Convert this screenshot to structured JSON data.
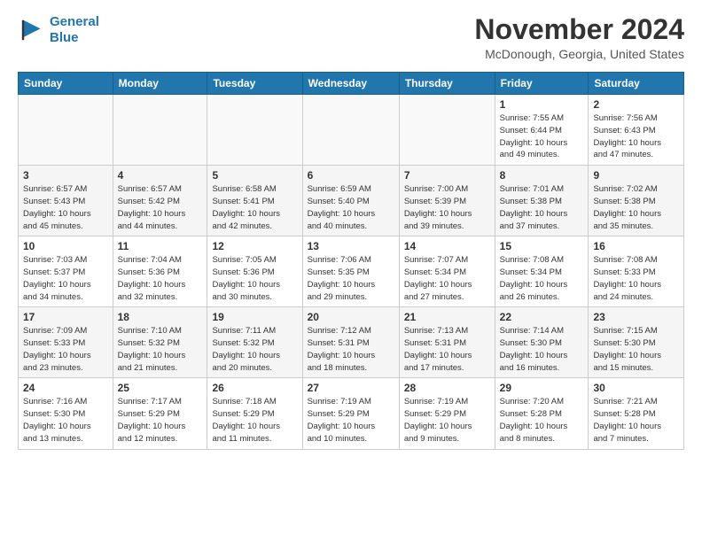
{
  "header": {
    "logo_line1": "General",
    "logo_line2": "Blue",
    "month": "November 2024",
    "location": "McDonough, Georgia, United States"
  },
  "days_of_week": [
    "Sunday",
    "Monday",
    "Tuesday",
    "Wednesday",
    "Thursday",
    "Friday",
    "Saturday"
  ],
  "weeks": [
    [
      {
        "day": "",
        "info": ""
      },
      {
        "day": "",
        "info": ""
      },
      {
        "day": "",
        "info": ""
      },
      {
        "day": "",
        "info": ""
      },
      {
        "day": "",
        "info": ""
      },
      {
        "day": "1",
        "info": "Sunrise: 7:55 AM\nSunset: 6:44 PM\nDaylight: 10 hours\nand 49 minutes."
      },
      {
        "day": "2",
        "info": "Sunrise: 7:56 AM\nSunset: 6:43 PM\nDaylight: 10 hours\nand 47 minutes."
      }
    ],
    [
      {
        "day": "3",
        "info": "Sunrise: 6:57 AM\nSunset: 5:43 PM\nDaylight: 10 hours\nand 45 minutes."
      },
      {
        "day": "4",
        "info": "Sunrise: 6:57 AM\nSunset: 5:42 PM\nDaylight: 10 hours\nand 44 minutes."
      },
      {
        "day": "5",
        "info": "Sunrise: 6:58 AM\nSunset: 5:41 PM\nDaylight: 10 hours\nand 42 minutes."
      },
      {
        "day": "6",
        "info": "Sunrise: 6:59 AM\nSunset: 5:40 PM\nDaylight: 10 hours\nand 40 minutes."
      },
      {
        "day": "7",
        "info": "Sunrise: 7:00 AM\nSunset: 5:39 PM\nDaylight: 10 hours\nand 39 minutes."
      },
      {
        "day": "8",
        "info": "Sunrise: 7:01 AM\nSunset: 5:38 PM\nDaylight: 10 hours\nand 37 minutes."
      },
      {
        "day": "9",
        "info": "Sunrise: 7:02 AM\nSunset: 5:38 PM\nDaylight: 10 hours\nand 35 minutes."
      }
    ],
    [
      {
        "day": "10",
        "info": "Sunrise: 7:03 AM\nSunset: 5:37 PM\nDaylight: 10 hours\nand 34 minutes."
      },
      {
        "day": "11",
        "info": "Sunrise: 7:04 AM\nSunset: 5:36 PM\nDaylight: 10 hours\nand 32 minutes."
      },
      {
        "day": "12",
        "info": "Sunrise: 7:05 AM\nSunset: 5:36 PM\nDaylight: 10 hours\nand 30 minutes."
      },
      {
        "day": "13",
        "info": "Sunrise: 7:06 AM\nSunset: 5:35 PM\nDaylight: 10 hours\nand 29 minutes."
      },
      {
        "day": "14",
        "info": "Sunrise: 7:07 AM\nSunset: 5:34 PM\nDaylight: 10 hours\nand 27 minutes."
      },
      {
        "day": "15",
        "info": "Sunrise: 7:08 AM\nSunset: 5:34 PM\nDaylight: 10 hours\nand 26 minutes."
      },
      {
        "day": "16",
        "info": "Sunrise: 7:08 AM\nSunset: 5:33 PM\nDaylight: 10 hours\nand 24 minutes."
      }
    ],
    [
      {
        "day": "17",
        "info": "Sunrise: 7:09 AM\nSunset: 5:33 PM\nDaylight: 10 hours\nand 23 minutes."
      },
      {
        "day": "18",
        "info": "Sunrise: 7:10 AM\nSunset: 5:32 PM\nDaylight: 10 hours\nand 21 minutes."
      },
      {
        "day": "19",
        "info": "Sunrise: 7:11 AM\nSunset: 5:32 PM\nDaylight: 10 hours\nand 20 minutes."
      },
      {
        "day": "20",
        "info": "Sunrise: 7:12 AM\nSunset: 5:31 PM\nDaylight: 10 hours\nand 18 minutes."
      },
      {
        "day": "21",
        "info": "Sunrise: 7:13 AM\nSunset: 5:31 PM\nDaylight: 10 hours\nand 17 minutes."
      },
      {
        "day": "22",
        "info": "Sunrise: 7:14 AM\nSunset: 5:30 PM\nDaylight: 10 hours\nand 16 minutes."
      },
      {
        "day": "23",
        "info": "Sunrise: 7:15 AM\nSunset: 5:30 PM\nDaylight: 10 hours\nand 15 minutes."
      }
    ],
    [
      {
        "day": "24",
        "info": "Sunrise: 7:16 AM\nSunset: 5:30 PM\nDaylight: 10 hours\nand 13 minutes."
      },
      {
        "day": "25",
        "info": "Sunrise: 7:17 AM\nSunset: 5:29 PM\nDaylight: 10 hours\nand 12 minutes."
      },
      {
        "day": "26",
        "info": "Sunrise: 7:18 AM\nSunset: 5:29 PM\nDaylight: 10 hours\nand 11 minutes."
      },
      {
        "day": "27",
        "info": "Sunrise: 7:19 AM\nSunset: 5:29 PM\nDaylight: 10 hours\nand 10 minutes."
      },
      {
        "day": "28",
        "info": "Sunrise: 7:19 AM\nSunset: 5:29 PM\nDaylight: 10 hours\nand 9 minutes."
      },
      {
        "day": "29",
        "info": "Sunrise: 7:20 AM\nSunset: 5:28 PM\nDaylight: 10 hours\nand 8 minutes."
      },
      {
        "day": "30",
        "info": "Sunrise: 7:21 AM\nSunset: 5:28 PM\nDaylight: 10 hours\nand 7 minutes."
      }
    ]
  ]
}
